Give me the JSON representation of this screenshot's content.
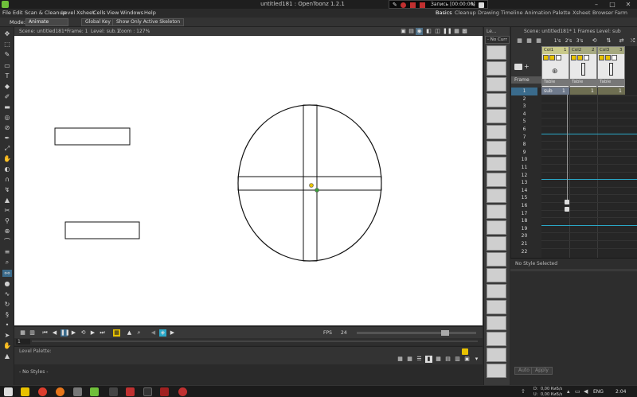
{
  "window": {
    "title": "untitled181 : OpenToonz 1.2.1"
  },
  "recorder": {
    "label": "Запись [00:00:00]"
  },
  "menus": [
    "File",
    "Edit",
    "Scan & Cleanup",
    "Level",
    "Xsheet",
    "Cells",
    "View",
    "Windows",
    "Help"
  ],
  "rooms": [
    "Basics",
    "Cleanup",
    "Drawing",
    "Timeline",
    "Animation",
    "Palette",
    "Xsheet",
    "Browser",
    "Farm"
  ],
  "toolOptions": {
    "mode_label": "Mode:",
    "mode_value": "Animate",
    "global_key": "Global Key",
    "show_skeleton": "Show Only Active Skeleton"
  },
  "viewer": {
    "scene": "Scene: untitled181*",
    "frame": "Frame: 1",
    "level": "Level: sub.1",
    "zoom": "Zoom : 127%"
  },
  "playbar": {
    "fps_label": "FPS",
    "fps_value": "24",
    "frame_field": "1"
  },
  "levelPalette": {
    "title": "Level Palette:",
    "no_styles": "- No Styles -"
  },
  "levelStrip": {
    "title": "Le...",
    "filter": "- No Curr"
  },
  "xsheet": {
    "header": "Scene: untitled181*   1 Frames  Level: sub",
    "zoom_buttons": [
      "1's",
      "2's",
      "3's"
    ],
    "frame_label": "Frame",
    "columns": [
      {
        "name": "Col1",
        "num": "1",
        "pegbar": "Table"
      },
      {
        "name": "Col2",
        "num": "2",
        "pegbar": "Table"
      },
      {
        "name": "Col3",
        "num": "3",
        "pegbar": "Table"
      }
    ],
    "row_numbers": [
      "1",
      "2",
      "3",
      "4",
      "5",
      "6",
      "7",
      "8",
      "9",
      "10",
      "11",
      "12",
      "13",
      "14",
      "15",
      "16",
      "17",
      "18",
      "19",
      "20",
      "21",
      "22"
    ],
    "cell_level": "sub",
    "cell_frame": "1",
    "marker_colors": {
      "cyan": "#2aa8c8"
    }
  },
  "styleEditor": {
    "status": "No Style Selected",
    "auto": "Auto",
    "apply": "Apply"
  },
  "taskbar": {
    "lang": "ENG",
    "time": "2:04",
    "net_d": "0,00 КиБ/s",
    "net_u": "0,00 КиБ/s",
    "d_label": "D:",
    "u_label": "U:"
  },
  "colors": {
    "accent": "#3a6b8c",
    "canvas": "#ffffff",
    "col_header": "#a6a97f"
  }
}
